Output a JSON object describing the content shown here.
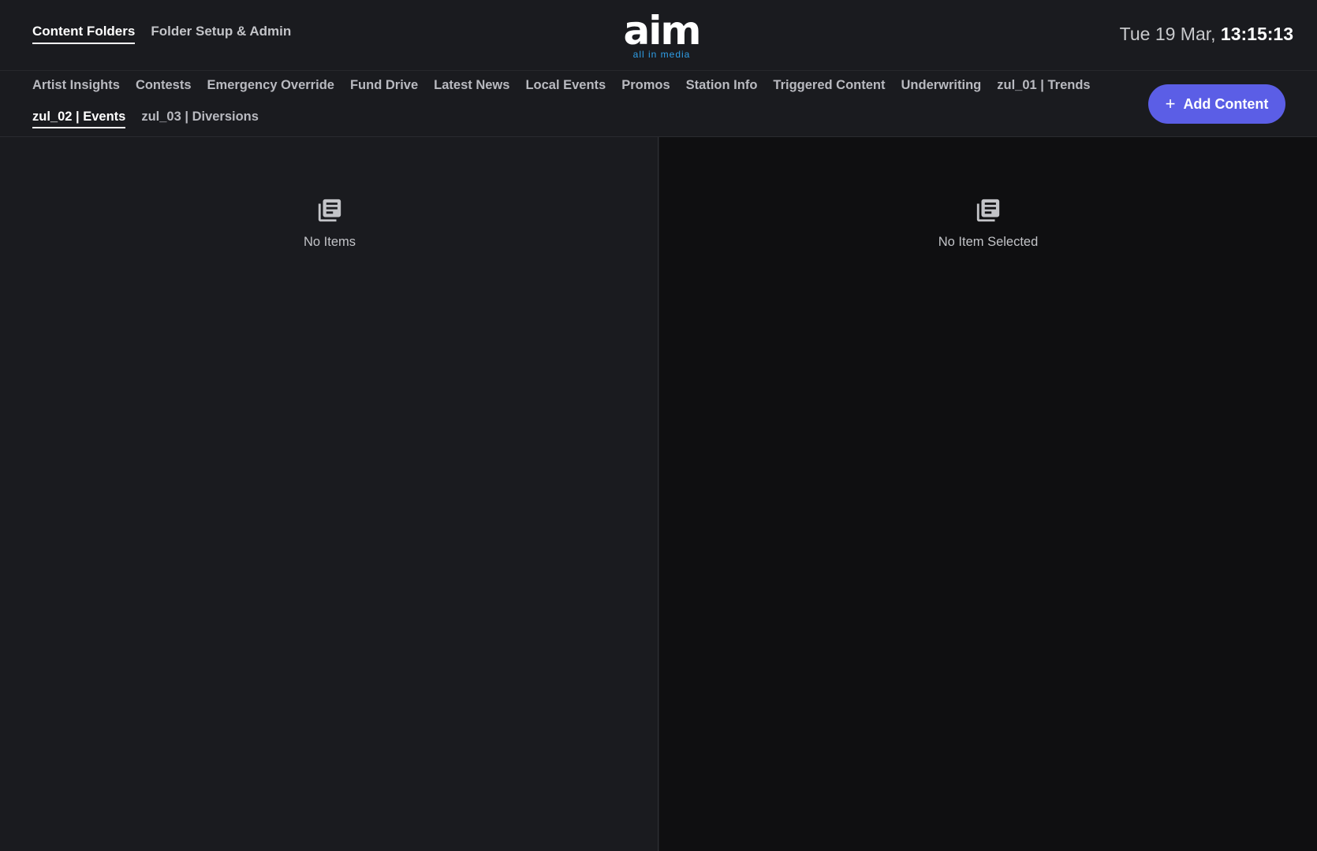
{
  "header": {
    "tabs": [
      {
        "label": "Content Folders",
        "active": true
      },
      {
        "label": "Folder Setup & Admin",
        "active": false
      }
    ],
    "logo": {
      "word": "aim",
      "tagline": "all in media"
    },
    "clock": {
      "date": "Tue 19 Mar,",
      "time": "13:15:13"
    }
  },
  "folders": {
    "items": [
      {
        "label": "Artist Insights"
      },
      {
        "label": "Contests"
      },
      {
        "label": "Emergency Override"
      },
      {
        "label": "Fund Drive"
      },
      {
        "label": "Latest News"
      },
      {
        "label": "Local Events"
      },
      {
        "label": "Promos"
      },
      {
        "label": "Station Info"
      },
      {
        "label": "Triggered Content"
      },
      {
        "label": "Underwriting"
      },
      {
        "label": "zul_01 | Trends"
      },
      {
        "label": "zul_02 | Events"
      },
      {
        "label": "zul_03 | Diversions"
      }
    ],
    "active_index": 11,
    "add_button": {
      "icon": "plus-icon",
      "label": "Add Content"
    }
  },
  "list_panel": {
    "icon": "library-books-icon",
    "empty_text": "No Items"
  },
  "detail_panel": {
    "icon": "library-books-icon",
    "empty_text": "No Item Selected"
  },
  "colors": {
    "accent": "#5b5ee6",
    "logo_tagline": "#2f9fe8",
    "background": "#1a1b1f",
    "detail_background": "#0f0f11"
  }
}
